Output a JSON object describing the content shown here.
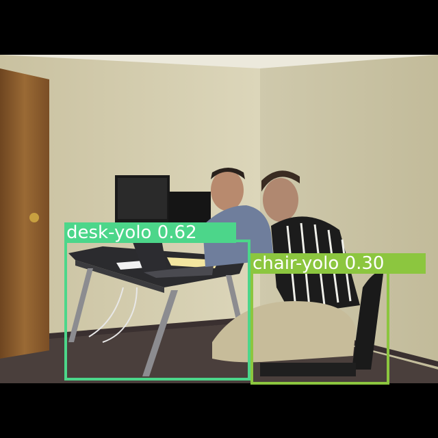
{
  "image": {
    "description_hidden": false
  },
  "detections": [
    {
      "class": "desk-yolo",
      "confidence": "0.62",
      "label": "desk-yolo 0.62",
      "color": "#4cd68a"
    },
    {
      "class": "chair-yolo",
      "confidence": "0.30",
      "label": "chair-yolo 0.30",
      "color": "#8cc63f"
    }
  ],
  "colors": {
    "background": "#000000",
    "wall": "#d8d2b4",
    "floor": "#4a3f3c",
    "door": "#8a5a2c"
  }
}
